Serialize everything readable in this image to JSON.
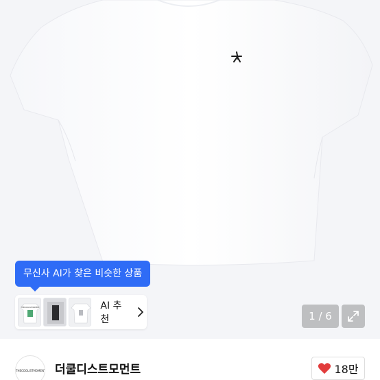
{
  "tooltip": {
    "text": "무신사 AI가 찾은 비슷한 상품"
  },
  "ai_recommend": {
    "label": "AI 추천",
    "thumbnails": [
      "tshirt-with-green-graphic",
      "photo-print-dark",
      "tshirt-white-graphic"
    ],
    "thumb_caption": "THECOOLISTMOMENT"
  },
  "gallery": {
    "pagination": "1 / 6",
    "icon": "expand-icon"
  },
  "store": {
    "logo_text": "THECOOLISTMOMENT",
    "name": "더쿨디스트모먼트"
  },
  "likes": {
    "count": "18만",
    "icon": "heart-icon",
    "color": "#e23c3c"
  },
  "colors": {
    "accent": "#2f6cf6",
    "background": "#f4f5f8"
  }
}
